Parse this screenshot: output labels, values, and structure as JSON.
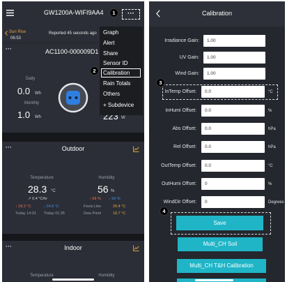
{
  "left": {
    "header": {
      "title": "GW1200A-WIFI9AA4",
      "more": "···"
    },
    "sunrise": {
      "label": "Sun Rise",
      "time": "06:53"
    },
    "reported": "Reported 45 seconds ago",
    "device_card": {
      "more": "···",
      "title": "AC1100-000009D1",
      "daily_label": "Daily",
      "daily_value": "0.0",
      "daily_unit": "Wh",
      "monthly_label": "Monthly",
      "monthly_value": "1.0",
      "monthly_unit": "Wh",
      "power_value": "223",
      "power_unit": "W"
    },
    "menu": {
      "items": [
        "Graph",
        "Alert",
        "Share",
        "Sensor ID",
        "Calibration",
        "Rain Totals",
        "Others",
        "+ Subdevice"
      ]
    },
    "outdoor": {
      "more": "···",
      "title": "Outdoor",
      "temperature": {
        "label": "Temperature",
        "value": "28.3",
        "unit": "°C",
        "trend": "↗ 0.4 °C/hr",
        "high": "↑ 28.3 °C",
        "low": "↓ 24.8 °C",
        "high_time": "Today 14:31",
        "low_time": "Today 01:35"
      },
      "humidity": {
        "label": "Humidity",
        "value": "56",
        "unit": "%",
        "high": "↑ 68 %",
        "low": "↓ 56 %",
        "feels_like_label": "Feels Like",
        "feels_like": "29.4 °C",
        "dew_point_label": "Dew Point",
        "dew_point": "18.7 °C"
      }
    },
    "indoor": {
      "more": "···",
      "title": "Indoor",
      "temperature_label": "Temperature",
      "humidity_label": "Humidity"
    }
  },
  "right": {
    "title": "Calibration",
    "gains": [
      {
        "label": "Irradiance Gain:",
        "value": "1.00"
      },
      {
        "label": "UV Gain:",
        "value": "1.00"
      },
      {
        "label": "Wind Gain:",
        "value": "1.00"
      }
    ],
    "offsets": [
      {
        "label": "InTemp Offset:",
        "value": "0.0",
        "unit": "°C"
      },
      {
        "label": "InHumi Offset:",
        "value": "0.0",
        "unit": "%"
      },
      {
        "label": "Abs Offset:",
        "value": "0.0",
        "unit": "hPa"
      },
      {
        "label": "Rel Offset:",
        "value": "0.0",
        "unit": "hPa"
      },
      {
        "label": "OutTemp Offset:",
        "value": "0.0",
        "unit": "°C"
      },
      {
        "label": "OutHumi Offset:",
        "value": "0",
        "unit": "%"
      },
      {
        "label": "WindDir Offset:",
        "value": "0",
        "unit": "Degrees"
      }
    ],
    "buttons": {
      "save": "Save",
      "multi_soil": "Multi_CH Soil",
      "multi_th": "Multi_CH T&H Calibration"
    }
  },
  "callouts": [
    "1",
    "2",
    "3",
    "4"
  ],
  "icons": {
    "menu": "hamburger-icon",
    "more": "more-icon",
    "back": "chevron-left-icon",
    "sunrise_nav": "chevron-left-icon",
    "plug": "plug-icon",
    "chart": "chart-icon"
  },
  "colors": {
    "accent": "#1fb5c7",
    "sunrise": "#e8a23a",
    "high": "#ef6a4c",
    "low": "#3f8fe8",
    "warm": "#e9a43b",
    "background": "#15171b",
    "card": "#2b2e36",
    "menu": "#1b1d21"
  }
}
